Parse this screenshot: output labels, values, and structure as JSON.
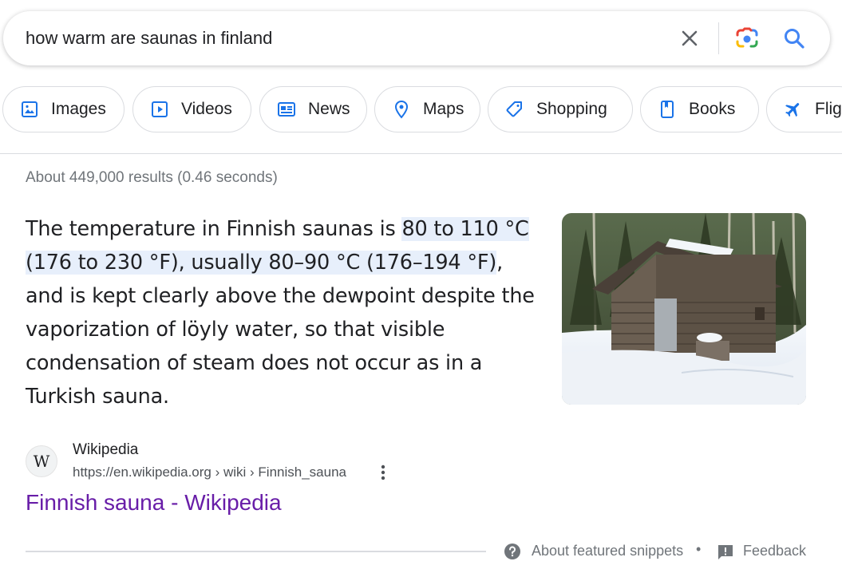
{
  "search": {
    "query": "how warm are saunas in finland",
    "clear_icon": "close-icon",
    "lens_icon": "google-lens-icon",
    "search_icon": "search-icon"
  },
  "chips": [
    {
      "label": "Images",
      "icon": "image-icon"
    },
    {
      "label": "Videos",
      "icon": "video-icon"
    },
    {
      "label": "News",
      "icon": "news-icon"
    },
    {
      "label": "Maps",
      "icon": "map-pin-icon"
    },
    {
      "label": "Shopping",
      "icon": "tag-icon"
    },
    {
      "label": "Books",
      "icon": "book-icon"
    },
    {
      "label": "Flig",
      "icon": "airplane-icon"
    }
  ],
  "result_stats": "About 449,000 results (0.46 seconds)",
  "snippet": {
    "text_before": "The temperature in Finnish saunas is ",
    "text_highlight": "80 to 110 °C (176 to 230 °F), usually 80–90 °C (176–194 °F)",
    "text_after": ", and is kept clearly above the dewpoint despite the vaporization of löyly water, so that visible condensation of steam does not occur as in a Turkish sauna."
  },
  "source": {
    "favicon_letter": "W",
    "site_name": "Wikipedia",
    "url": "https://en.wikipedia.org › wiki › Finnish_sauna",
    "title": "Finnish sauna - Wikipedia"
  },
  "footer": {
    "about_label": "About featured snippets",
    "separator": "•",
    "feedback_label": "Feedback"
  },
  "colors": {
    "link_visited": "#681da8",
    "highlight": "#e7effb",
    "search_blue": "#4285f4"
  }
}
